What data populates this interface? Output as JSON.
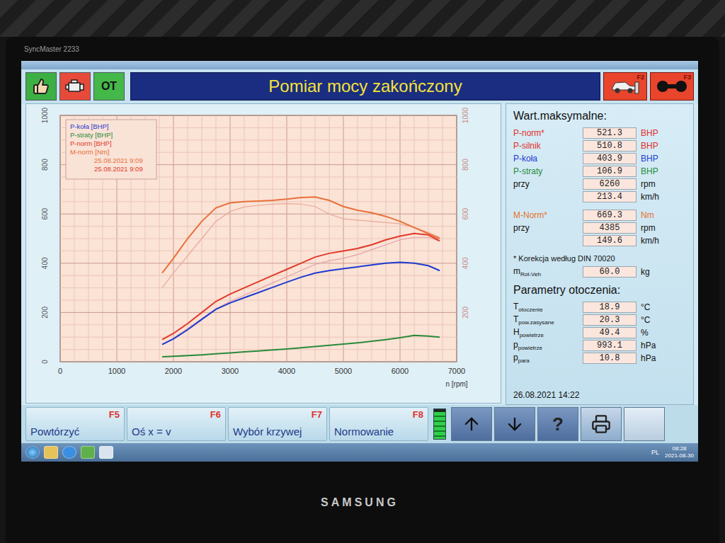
{
  "monitor": {
    "model": "SyncMaster 2233",
    "brand": "SAMSUNG"
  },
  "header": {
    "status_buttons": [
      {
        "kind": "thumb",
        "color": "#3cb043"
      },
      {
        "kind": "engine",
        "color": "#e84a3a"
      },
      {
        "kind": "text",
        "label": "OT",
        "color": "#45b84a"
      }
    ],
    "title": "Pomiar mocy zakończony",
    "right_buttons": [
      {
        "kind": "car",
        "key": "F2"
      },
      {
        "kind": "rollers",
        "key": "F3"
      }
    ]
  },
  "chart": {
    "x_axis": {
      "ticks": [
        "0",
        "1000",
        "2000",
        "3000",
        "4000",
        "5000",
        "6000",
        "7000"
      ],
      "label": "n [rpm]"
    },
    "y_axis_left": {
      "ticks": [
        "0",
        "200",
        "400",
        "600",
        "800",
        "1000"
      ]
    },
    "y_axis_right": {
      "ticks": [
        "200",
        "400",
        "600",
        "800",
        "1000"
      ]
    },
    "rpm": [
      1800,
      2000,
      2250,
      2500,
      2750,
      3000,
      3250,
      3500,
      3750,
      4000,
      4250,
      4500,
      4750,
      5000,
      5250,
      5500,
      5750,
      6000,
      6250,
      6500,
      6700
    ],
    "series": [
      {
        "name": "P-koła [BHP]",
        "color": "#1e3ad0",
        "values": [
          70,
          93,
          130,
          172,
          213,
          239,
          260,
          281,
          302,
          323,
          343,
          360,
          370,
          378,
          385,
          393,
          400,
          404,
          400,
          390,
          370
        ]
      },
      {
        "name": "P-straty [BHP]",
        "color": "#2a8a3a",
        "values": [
          20,
          22,
          25,
          28,
          32,
          36,
          40,
          44,
          48,
          52,
          57,
          62,
          67,
          72,
          77,
          83,
          90,
          98,
          107,
          104,
          100
        ]
      },
      {
        "name": "P-norm [BHP]",
        "color": "#e03a2a",
        "values": [
          90,
          115,
          155,
          200,
          245,
          275,
          300,
          325,
          350,
          375,
          400,
          425,
          440,
          450,
          460,
          475,
          495,
          510,
          521,
          515,
          490
        ]
      },
      {
        "name": "M-norm [Nm]",
        "color": "#e8703a",
        "values": [
          360,
          420,
          500,
          570,
          625,
          645,
          650,
          652,
          655,
          660,
          667,
          669,
          655,
          630,
          615,
          605,
          590,
          570,
          545,
          520,
          500
        ]
      }
    ],
    "reference_series": [
      {
        "color": "#e8a89a",
        "values": [
          300,
          360,
          430,
          500,
          570,
          610,
          628,
          635,
          640,
          642,
          640,
          630,
          600,
          580,
          575,
          570,
          565,
          560,
          545,
          525,
          505
        ]
      },
      {
        "color": "#e3a0a8",
        "values": [
          70,
          95,
          135,
          175,
          215,
          245,
          270,
          295,
          320,
          345,
          370,
          395,
          410,
          420,
          435,
          455,
          475,
          495,
          505,
          505,
          490
        ]
      }
    ],
    "legend_dates": [
      "25.08.2021 9:09",
      "25.08.2021 9:09"
    ]
  },
  "max_values": {
    "title": "Wart.maksymalne:",
    "groups": [
      [
        {
          "label": "P-norm*",
          "value": "521.3",
          "unit": "BHP",
          "color": "#e0302a"
        },
        {
          "label": "P-silnik",
          "value": "510.8",
          "unit": "BHP",
          "color": "#e0302a"
        },
        {
          "label": "P-koła",
          "value": "403.9",
          "unit": "BHP",
          "color": "#1e3ad0"
        },
        {
          "label": "P-straty",
          "value": "106.9",
          "unit": "BHP",
          "color": "#1f8a3a"
        },
        {
          "label": "przy",
          "value": "6260",
          "unit": "rpm",
          "color": "#111111"
        },
        {
          "label": "",
          "value": "213.4",
          "unit": "km/h",
          "color": "#111111"
        }
      ],
      [
        {
          "label": "M-Norm*",
          "value": "669.3",
          "unit": "Nm",
          "color": "#e8702a"
        },
        {
          "label": "przy",
          "value": "4385",
          "unit": "rpm",
          "color": "#111111"
        },
        {
          "label": "",
          "value": "149.6",
          "unit": "km/h",
          "color": "#111111"
        }
      ]
    ],
    "note": "* Korekcja według DIN 70020",
    "mass": {
      "label": "m",
      "sub": "Rot-Veh",
      "value": "60.0",
      "unit": "kg"
    }
  },
  "ambient": {
    "title": "Parametry otoczenia:",
    "rows": [
      {
        "label": "T",
        "sub": "otoczenie",
        "value": "18.9",
        "unit": "°C"
      },
      {
        "label": "T",
        "sub": "pow.zasysane",
        "value": "20.3",
        "unit": "°C"
      },
      {
        "label": "H",
        "sub": "powietrze",
        "value": "49.4",
        "unit": "%"
      },
      {
        "label": "p",
        "sub": "powietrze",
        "value": "993.1",
        "unit": "hPa"
      },
      {
        "label": "p",
        "sub": "para",
        "value": "10.8",
        "unit": "hPa"
      }
    ]
  },
  "timestamp": "26.08.2021 14:22",
  "toolbar": {
    "function_buttons": [
      {
        "label": "Powtórzyć",
        "key": "F5"
      },
      {
        "label": "Oś x = v",
        "key": "F6"
      },
      {
        "label": "Wybór krzywej",
        "key": "F7"
      },
      {
        "label": "Normowanie",
        "key": "F8"
      }
    ],
    "indicator": {
      "level": 0.9
    },
    "icon_buttons": [
      {
        "kind": "up"
      },
      {
        "kind": "down"
      },
      {
        "kind": "help",
        "label": "?"
      },
      {
        "kind": "print"
      },
      {
        "kind": "blank"
      }
    ]
  },
  "taskbar": {
    "language": "PL",
    "time": "08:28",
    "date": "2021-08-30"
  }
}
